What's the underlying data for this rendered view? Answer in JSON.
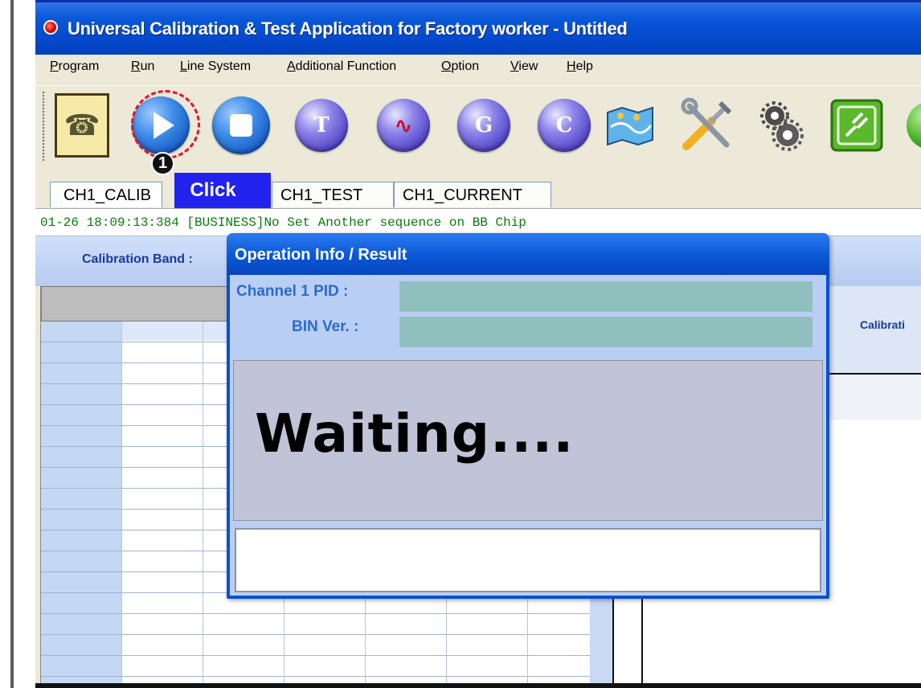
{
  "window": {
    "title": "Universal Calibration & Test Application for Factory worker - Untitled"
  },
  "menu": [
    "Program",
    "Run",
    "Line System",
    "Additional Function",
    "Option",
    "View",
    "Help"
  ],
  "toolbar": {
    "icons": [
      "phone-check-icon",
      "play-icon",
      "stop-icon",
      "t-icon",
      "waveform-icon",
      "g-icon",
      "c-icon",
      "map-icon",
      "tools-icon",
      "gears-icon",
      "cable-icon"
    ],
    "letters": {
      "t": "T",
      "g": "G",
      "c": "C"
    }
  },
  "annotation": {
    "step_number": "1",
    "click_label": "Click"
  },
  "tabs": [
    "CH1_CALIB",
    "CH1_TEST",
    "CH1_CURRENT"
  ],
  "log": {
    "line": "01-26  18:09:13:384 [BUSINESS]No Set Another sequence on BB Chip"
  },
  "band": {
    "label": "Calibration Band :"
  },
  "right_panel": {
    "label": "Calibrati"
  },
  "dialog": {
    "title": "Operation Info / Result",
    "pid_label": "Channel 1 PID :",
    "pid_value": "",
    "bin_label": "BIN Ver. :",
    "bin_value": "",
    "status": "Waiting....",
    "message": ""
  }
}
